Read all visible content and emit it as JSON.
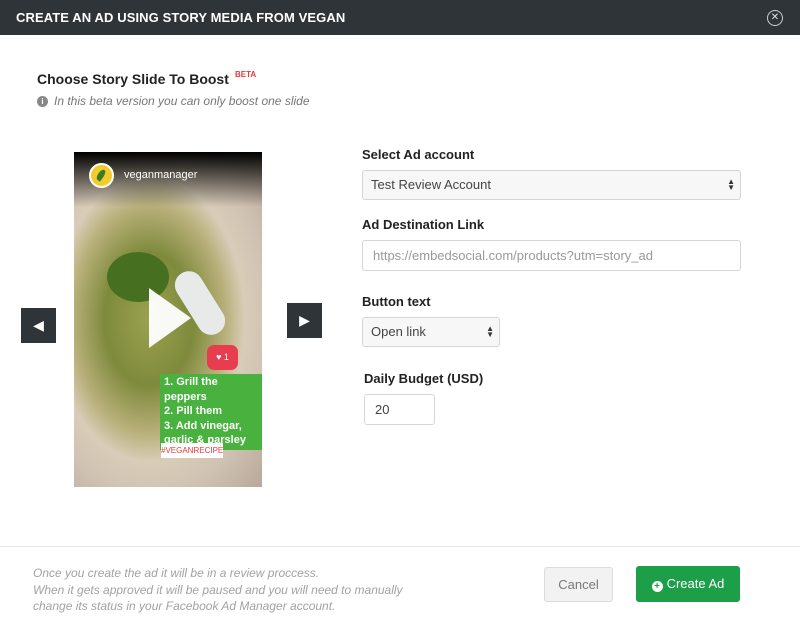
{
  "header": {
    "title": "CREATE AN AD USING STORY MEDIA FROM VEGAN"
  },
  "section": {
    "title": "Choose Story Slide To Boost",
    "badge": "BETA",
    "note": "In this beta version you can only boost one slide"
  },
  "story": {
    "username": "veganmanager",
    "likes": "1",
    "recipe_lines": [
      "1. Grill the peppers",
      "2. Pill them",
      "3. Add vinegar,",
      "garlic & parsley"
    ],
    "hashtag": "#VEGANRECIPE"
  },
  "icons": {
    "close": "close-icon",
    "info": "info-icon",
    "prev": "arrow-left-icon",
    "next": "arrow-right-icon",
    "play": "play-icon",
    "heart": "heart-icon",
    "plus": "plus-circle-icon"
  },
  "form": {
    "ad_account_label": "Select Ad account",
    "ad_account_value": "Test Review Account",
    "destination_label": "Ad Destination Link",
    "destination_placeholder": "https://embedsocial.com/products?utm=story_ad",
    "button_text_label": "Button text",
    "button_text_value": "Open link",
    "budget_label": "Daily Budget (USD)",
    "budget_value": "20"
  },
  "footer": {
    "note_lines": [
      "Once you create the ad it will be in a review proccess.",
      "When it gets approved it will be paused and you will need to manually",
      "change its status in your  Facebook Ad Manager account."
    ],
    "cancel_label": "Cancel",
    "create_label": "Create Ad"
  },
  "colors": {
    "header_bg": "#2e3438",
    "primary_button": "#1d9e48",
    "beta_badge": "#e23b3b",
    "recipe_bg": "#49b23f"
  }
}
